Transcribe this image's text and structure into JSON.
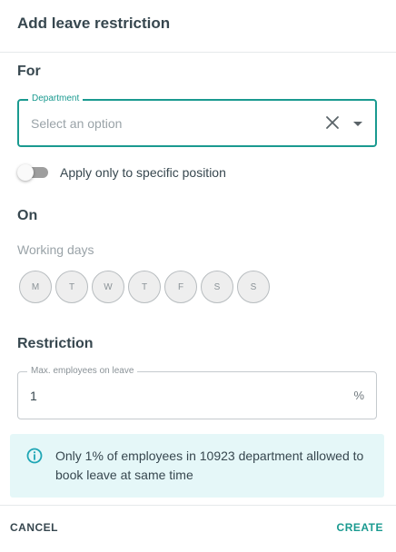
{
  "dialog": {
    "title": "Add leave restriction"
  },
  "for_section": {
    "title": "For",
    "department": {
      "label": "Department",
      "placeholder": "Select an option"
    },
    "position_toggle": {
      "label": "Apply only to specific position",
      "on": false
    }
  },
  "on_section": {
    "title": "On",
    "working_days_label": "Working days",
    "days": [
      "M",
      "T",
      "W",
      "T",
      "F",
      "S",
      "S"
    ]
  },
  "restriction_section": {
    "title": "Restriction",
    "max_employees": {
      "label": "Max. employees on leave",
      "value": "1",
      "suffix": "%"
    }
  },
  "info": {
    "text": "Only 1% of employees in 10923 department allowed to book leave at same time"
  },
  "footer": {
    "cancel_label": "CANCEL",
    "create_label": "CREATE"
  },
  "colors": {
    "accent": "#1a9a90",
    "info_bg": "#e5f7f8",
    "text": "#37474f",
    "muted": "#9aa3a8"
  },
  "icons": {
    "clear": "close-icon",
    "dropdown": "chevron-down-icon",
    "info": "info-icon"
  }
}
